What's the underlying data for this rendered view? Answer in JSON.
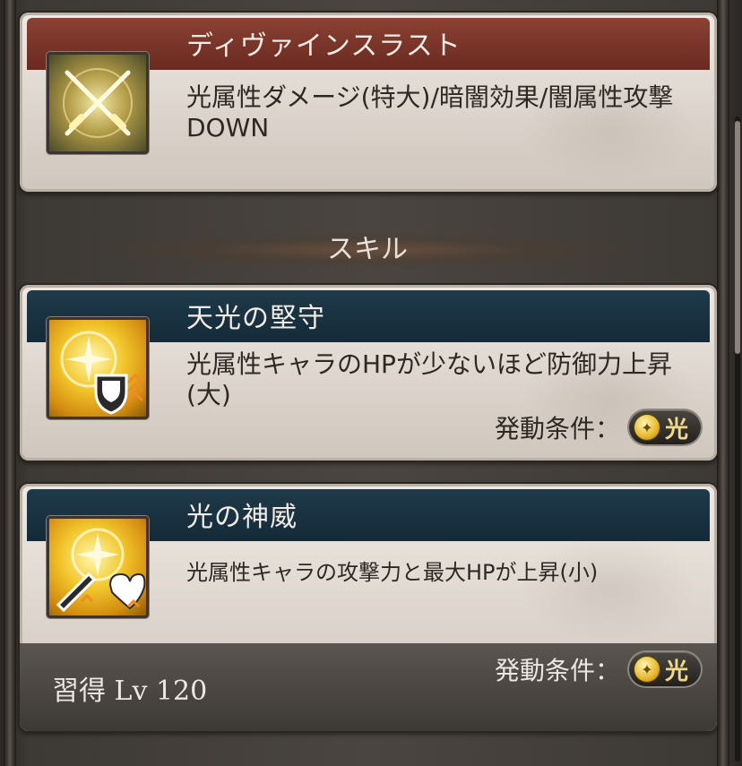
{
  "ability": {
    "title": "ディヴァインスラスト",
    "description": "光属性ダメージ(特大)/暗闇効果/闇属性攻撃DOWN",
    "icon": "crossed-swords-icon"
  },
  "section_label": "スキル",
  "skills": [
    {
      "title": "天光の堅守",
      "description": "光属性キャラのHPが少ないほど防御力上昇(大)",
      "condition_label": "発動条件：",
      "condition_value": "光",
      "icon": "shield-defense-up-icon"
    },
    {
      "title": "光の神威",
      "description": "光属性キャラの攻撃力と最大HPが上昇(小)",
      "condition_label": "発動条件：",
      "condition_value": "光",
      "acquire_label": "習得 Lv 120",
      "icon": "attack-hp-up-icon"
    }
  ],
  "colors": {
    "ability_header": "#7a3428",
    "skill_header": "#1a3242",
    "light_element": "#e7b628"
  }
}
